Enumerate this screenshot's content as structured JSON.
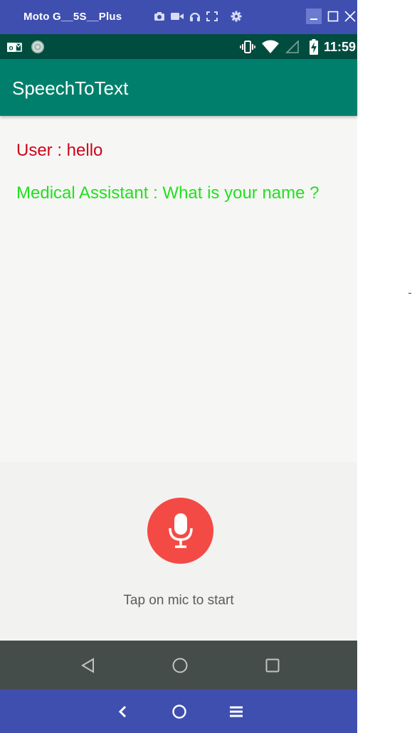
{
  "emulator": {
    "title": "Moto G__5S__Plus",
    "toolbar_icons": [
      "camera-icon",
      "video-icon",
      "headphones-icon",
      "fullscreen-icon",
      "settings-icon"
    ],
    "window_controls": [
      "minimize-icon",
      "maximize-icon",
      "close-icon"
    ],
    "bottom_controls": [
      "back-icon",
      "home-icon",
      "menu-icon"
    ],
    "accent": "#3f4fb0"
  },
  "status_bar": {
    "left_icons": [
      "outlook-icon",
      "sync-icon"
    ],
    "right_icons": [
      "vibrate-icon",
      "wifi-icon",
      "signal-icon",
      "battery-charging-icon"
    ],
    "time": "11:59",
    "color": "#004d40"
  },
  "app_bar": {
    "title": "SpeechToText",
    "color": "#00806c"
  },
  "conversation": {
    "messages": [
      {
        "text": "User : hello",
        "color": "#d0021b"
      },
      {
        "text": "Medical Assistant : What is your name ?",
        "color": "#22e01e"
      }
    ]
  },
  "mic": {
    "icon": "microphone-icon",
    "hint": "Tap on mic to start",
    "color": "#f44a45"
  },
  "nav_bar": {
    "buttons": [
      "nav-back-icon",
      "nav-home-icon",
      "nav-recents-icon"
    ]
  }
}
